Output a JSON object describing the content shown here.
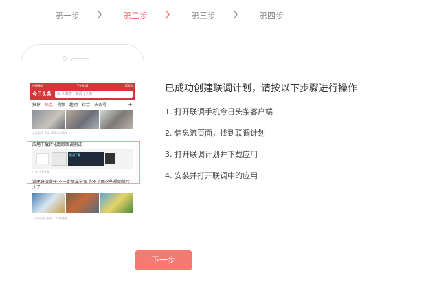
{
  "stepper": {
    "steps": [
      {
        "label": "第一步",
        "active": false
      },
      {
        "label": "第二步",
        "active": true
      },
      {
        "label": "第三步",
        "active": false
      },
      {
        "label": "第四步",
        "active": false
      }
    ]
  },
  "phone": {
    "status": {
      "carrier": "中国移动",
      "time": "下午3:45",
      "battery": "100%"
    },
    "logo": "今日头条",
    "search_placeholder": "人数学 | 新闻 | 头条",
    "tabs": [
      "推荐",
      "热点",
      "视频",
      "趣动",
      "社会",
      "头条号"
    ],
    "active_tab": "热点",
    "plus": "+",
    "news1_meta": "头条新闻 评论 423 2小时前",
    "ad": {
      "title": "应用下载转化跟踪联调测试",
      "banner_text": "联调下载",
      "meta": "广告 今日头条"
    },
    "news2": {
      "title": "追尾分清责任 不一定后车全责 你不了解这些规则就亏大了",
      "meta": "汽车头条 评论 3 20分钟前"
    }
  },
  "instructions": {
    "heading": "已成功创建联调计划，请按以下步骤进行操作",
    "items": [
      "1. 打开联调手机今日头条客户端",
      "2. 信息流页面，找到联调计划",
      "3. 打开联调计划并下载应用",
      "4. 安装并打开联调中的应用"
    ]
  },
  "next_button": {
    "label": "下一步"
  },
  "colors": {
    "accent": "#f0656a",
    "button": "#f47a72",
    "app_red": "#d6363a"
  }
}
